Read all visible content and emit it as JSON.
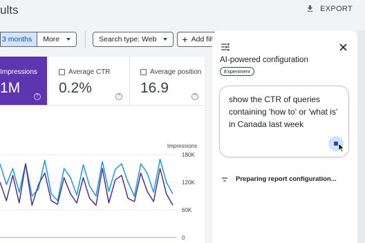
{
  "header": {
    "title": "ults",
    "export_label": "EXPORT",
    "export_icon": "download-icon"
  },
  "filters": {
    "date_range": "3 months",
    "more_label": "More",
    "search_type": "Search type: Web",
    "add_filter": "Add filt"
  },
  "metrics": [
    {
      "label": "Impressions",
      "value": "1M",
      "checked": true
    },
    {
      "label": "Average CTR",
      "value": "0.2%",
      "checked": false
    },
    {
      "label": "Average position",
      "value": "16.9",
      "checked": false
    }
  ],
  "chart_data": {
    "type": "line",
    "ylabel": "Impressions",
    "y_ticks": [
      "180K",
      "120K",
      "60K",
      "0"
    ],
    "ylim": [
      0,
      180000
    ],
    "series": [
      {
        "color": "#1a9bd7",
        "values": [
          160000,
          115000,
          150000,
          98000,
          160000,
          90000,
          105000,
          168000,
          95000,
          80000,
          150000,
          130000,
          92000,
          158000,
          112000,
          90000,
          165000,
          100000,
          148000,
          160000,
          120000,
          90000,
          160000,
          140000,
          98000,
          170000,
          120000,
          95000
        ]
      },
      {
        "color": "#4a2f9e",
        "values": [
          120000,
          80000,
          135000,
          75000,
          160000,
          70000,
          115000,
          140000,
          80000,
          72000,
          130000,
          95000,
          75000,
          130000,
          85000,
          70000,
          150000,
          75000,
          125000,
          135000,
          85000,
          78000,
          140000,
          100000,
          78000,
          150000,
          95000,
          70000
        ]
      }
    ],
    "colors": {
      "clicks": "#4a2f9e",
      "impressions": "#1a9bd7"
    }
  },
  "panel": {
    "title": "AI-powered configuration",
    "badge": "Experiment",
    "prompt": "show the CTR of queries containing 'how to' or 'what is' in Canada  last week",
    "status": "Preparing report configuration...",
    "accent": "#0b57d0"
  }
}
